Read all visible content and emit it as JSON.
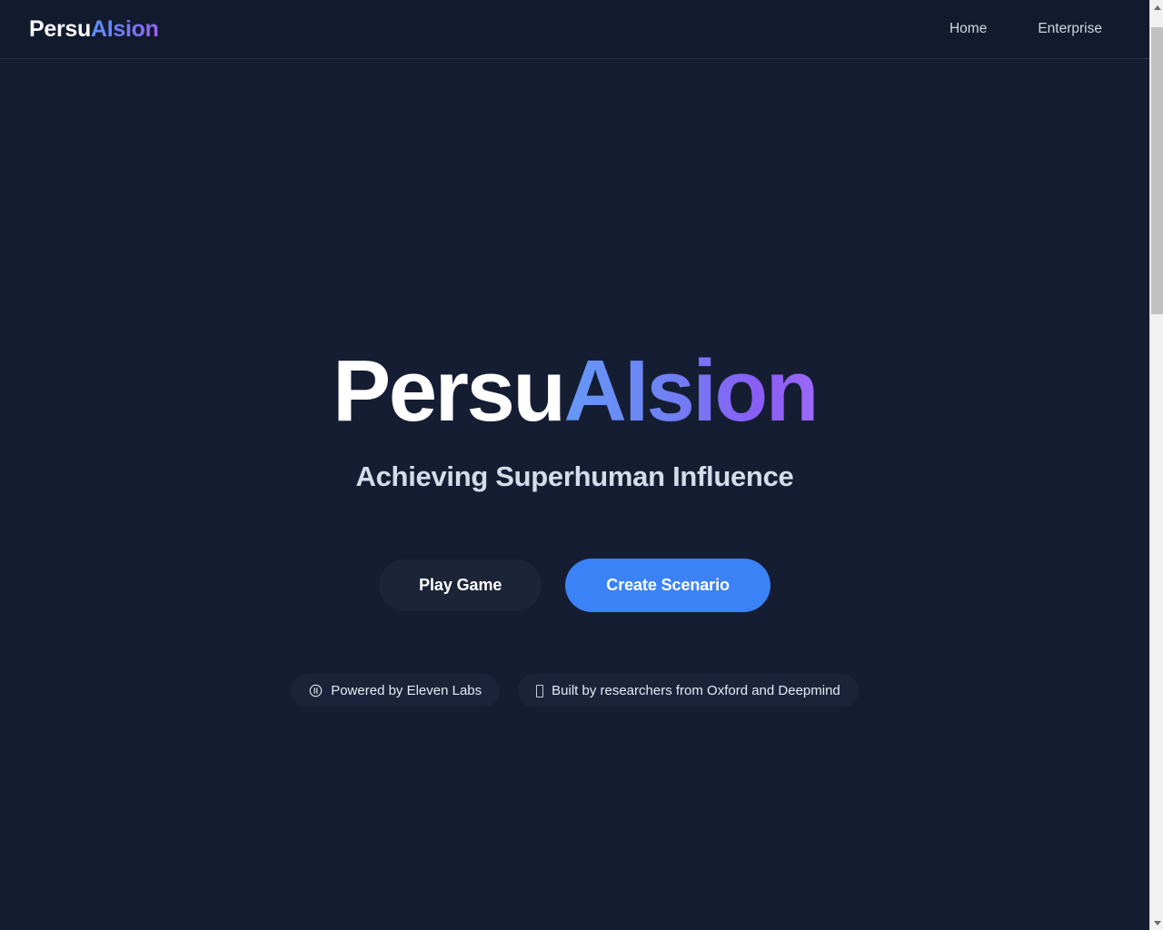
{
  "header": {
    "logo": {
      "part1": "Persu",
      "part2": "AIsion",
      "gradient_from": "#5c93f7",
      "gradient_to": "#9a63f0"
    },
    "nav": [
      {
        "label": "Home",
        "name": "nav-link-home"
      },
      {
        "label": "Enterprise",
        "name": "nav-link-enterprise"
      }
    ]
  },
  "hero": {
    "title": {
      "part1": "Persu",
      "part2": "AIsion"
    },
    "subtitle": "Achieving Superhuman Influence",
    "buttons": {
      "secondary_label": "Play Game",
      "primary_label": "Create Scenario"
    },
    "badges": [
      {
        "icon": "audio-circle-icon",
        "text": "Powered by Eleven Labs"
      },
      {
        "icon": "missing-glyph-icon",
        "text": "Built by researchers from Oxford and Deepmind"
      }
    ]
  },
  "theme": {
    "page_background": "#151d33",
    "header_background": "#121a2e",
    "primary_button": "#3b82f6",
    "secondary_button": "#1c2438",
    "title_gradient_from": "#6699f6",
    "title_gradient_to": "#9a6bf7"
  }
}
